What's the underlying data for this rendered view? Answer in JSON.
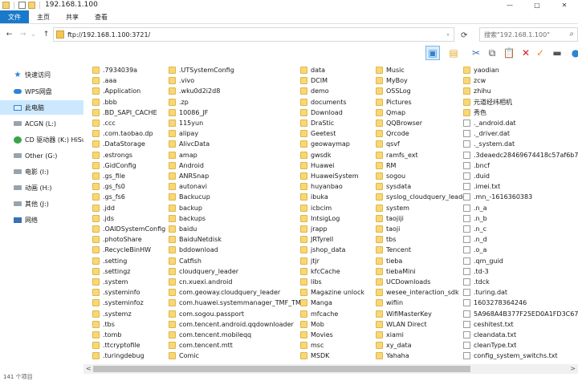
{
  "window": {
    "title": "192.168.1.100",
    "controls": [
      "—",
      "□",
      "✕"
    ]
  },
  "ribbon": {
    "tabs": [
      "文件",
      "主页",
      "共享",
      "查看"
    ]
  },
  "address": {
    "back": "←",
    "forward": "→",
    "recent": "⌄",
    "up": "↑",
    "path": "ftp://192.168.1.100:3721/",
    "dropdown": "⌄",
    "refresh": "⟳",
    "search_placeholder": "搜索\"192.168.1.100\"",
    "search_icon": "⌕"
  },
  "toolbar": {
    "colors": {
      "accent": "#1979ca",
      "selected": "#cce8ff",
      "delete": "#d11a2a",
      "check": "#e98b1a"
    },
    "buttons": [
      {
        "name": "layout-pane-icon",
        "glyph": "▣",
        "color": "#2f84d3"
      },
      {
        "name": "view-options-icon",
        "glyph": "▤",
        "color": "#e0a82e"
      },
      {
        "name": "cut-icon",
        "glyph": "✂",
        "color": "#3b6fb6"
      },
      {
        "name": "copy-icon",
        "glyph": "⧉",
        "color": "#555555"
      },
      {
        "name": "paste-icon",
        "glyph": "📋",
        "color": "#555555"
      },
      {
        "name": "delete-icon",
        "glyph": "✕",
        "color": "#d11a2a"
      },
      {
        "name": "checkmark-icon",
        "glyph": "✓",
        "color": "#e98b1a"
      },
      {
        "name": "rename-icon",
        "glyph": "▬",
        "color": "#555555"
      },
      {
        "name": "globe-icon",
        "glyph": "●",
        "color": "#2f84d3"
      }
    ]
  },
  "sidebar": {
    "items": [
      {
        "label": "快速访问",
        "icon": "star-icon"
      },
      {
        "label": "WPS网盘",
        "icon": "cloud-icon"
      },
      {
        "label": "此电脑",
        "icon": "computer-icon",
        "selected": true
      },
      {
        "label": "ACGN (L:)",
        "icon": "drive-icon"
      },
      {
        "label": "CD 驱动器 (K:) HiSu",
        "icon": "cd-drive-icon"
      },
      {
        "label": "Other (G:)",
        "icon": "drive-icon"
      },
      {
        "label": "电影 (I:)",
        "icon": "drive-icon"
      },
      {
        "label": "动画 (H:)",
        "icon": "drive-icon"
      },
      {
        "label": "其他 (J:)",
        "icon": "drive-icon"
      },
      {
        "label": "网络",
        "icon": "network-icon"
      }
    ]
  },
  "files": {
    "columns": [
      [
        {
          "n": ".7934039a",
          "t": "folder"
        },
        {
          "n": ".aaa",
          "t": "folder"
        },
        {
          "n": ".Application",
          "t": "folder"
        },
        {
          "n": ".bbb",
          "t": "folder"
        },
        {
          "n": ".BD_SAPI_CACHE",
          "t": "folder"
        },
        {
          "n": ".ccc",
          "t": "folder"
        },
        {
          "n": ".com.taobao.dp",
          "t": "folder"
        },
        {
          "n": ".DataStorage",
          "t": "folder"
        },
        {
          "n": ".estrongs",
          "t": "folder"
        },
        {
          "n": ".GidConfig",
          "t": "folder"
        },
        {
          "n": ".gs_file",
          "t": "folder"
        },
        {
          "n": ".gs_fs0",
          "t": "folder"
        },
        {
          "n": ".gs_fs6",
          "t": "folder"
        },
        {
          "n": ".jdd",
          "t": "folder"
        },
        {
          "n": ".jds",
          "t": "folder"
        },
        {
          "n": ".OAIDSystemConfig",
          "t": "folder"
        },
        {
          "n": ".photoShare",
          "t": "folder"
        },
        {
          "n": ".RecycleBinHW",
          "t": "folder"
        },
        {
          "n": ".setting",
          "t": "folder"
        },
        {
          "n": ".settingz",
          "t": "folder"
        },
        {
          "n": ".system",
          "t": "folder"
        },
        {
          "n": ".systeminfo",
          "t": "folder"
        },
        {
          "n": ".systeminfoz",
          "t": "folder"
        },
        {
          "n": ".systemz",
          "t": "folder"
        },
        {
          "n": ".tbs",
          "t": "folder"
        },
        {
          "n": ".tomb",
          "t": "folder"
        },
        {
          "n": ".ttcryptofile",
          "t": "folder"
        },
        {
          "n": ".turingdebug",
          "t": "folder"
        }
      ],
      [
        {
          "n": ".UTSystemConfig",
          "t": "folder"
        },
        {
          "n": ".vivo",
          "t": "folder"
        },
        {
          "n": ".wku0d2i2d8",
          "t": "folder"
        },
        {
          "n": ".zp",
          "t": "folder"
        },
        {
          "n": "10086_JF",
          "t": "folder"
        },
        {
          "n": "115yun",
          "t": "folder"
        },
        {
          "n": "alipay",
          "t": "folder"
        },
        {
          "n": "AlivcData",
          "t": "folder"
        },
        {
          "n": "amap",
          "t": "folder"
        },
        {
          "n": "Android",
          "t": "folder"
        },
        {
          "n": "ANRSnap",
          "t": "folder"
        },
        {
          "n": "autonavi",
          "t": "folder"
        },
        {
          "n": "Backucup",
          "t": "folder"
        },
        {
          "n": "backup",
          "t": "folder"
        },
        {
          "n": "backups",
          "t": "folder"
        },
        {
          "n": "baidu",
          "t": "folder"
        },
        {
          "n": "BaiduNetdisk",
          "t": "folder"
        },
        {
          "n": "bddownload",
          "t": "folder"
        },
        {
          "n": "Catfish",
          "t": "folder"
        },
        {
          "n": "cloudquery_leader",
          "t": "folder"
        },
        {
          "n": "cn.xuexi.android",
          "t": "folder"
        },
        {
          "n": "com.geoway.cloudquery_leader",
          "t": "folder"
        },
        {
          "n": "com.huawei.systemmanager_TMF_TMS",
          "t": "folder"
        },
        {
          "n": "com.sogou.passport",
          "t": "folder"
        },
        {
          "n": "com.tencent.android.qqdownloader",
          "t": "folder"
        },
        {
          "n": "com.tencent.mobileqq",
          "t": "folder"
        },
        {
          "n": "com.tencent.mtt",
          "t": "folder"
        },
        {
          "n": "Comic",
          "t": "folder"
        }
      ],
      [
        {
          "n": "data",
          "t": "folder"
        },
        {
          "n": "DCIM",
          "t": "folder"
        },
        {
          "n": "demo",
          "t": "folder"
        },
        {
          "n": "documents",
          "t": "folder"
        },
        {
          "n": "Download",
          "t": "folder"
        },
        {
          "n": "DraStic",
          "t": "folder"
        },
        {
          "n": "Geetest",
          "t": "folder"
        },
        {
          "n": "geowaymap",
          "t": "folder"
        },
        {
          "n": "gwsdk",
          "t": "folder"
        },
        {
          "n": "Huawei",
          "t": "folder"
        },
        {
          "n": "HuaweiSystem",
          "t": "folder"
        },
        {
          "n": "huyanbao",
          "t": "folder"
        },
        {
          "n": "ibuka",
          "t": "folder"
        },
        {
          "n": "icbcim",
          "t": "folder"
        },
        {
          "n": "IntsigLog",
          "t": "folder"
        },
        {
          "n": "jrapp",
          "t": "folder"
        },
        {
          "n": "JRTyrell",
          "t": "folder"
        },
        {
          "n": "jshop_data",
          "t": "folder"
        },
        {
          "n": "jtjr",
          "t": "folder"
        },
        {
          "n": "kfcCache",
          "t": "folder"
        },
        {
          "n": "libs",
          "t": "folder"
        },
        {
          "n": "Magazine unlock",
          "t": "folder"
        },
        {
          "n": "Manga",
          "t": "folder"
        },
        {
          "n": "mfcache",
          "t": "folder"
        },
        {
          "n": "Mob",
          "t": "folder"
        },
        {
          "n": "Movies",
          "t": "folder"
        },
        {
          "n": "msc",
          "t": "folder"
        },
        {
          "n": "MSDK",
          "t": "folder"
        }
      ],
      [
        {
          "n": "Music",
          "t": "folder"
        },
        {
          "n": "MyBoy",
          "t": "folder"
        },
        {
          "n": "OSSLog",
          "t": "folder"
        },
        {
          "n": "Pictures",
          "t": "folder"
        },
        {
          "n": "Qmap",
          "t": "folder"
        },
        {
          "n": "QQBrowser",
          "t": "folder"
        },
        {
          "n": "Qrcode",
          "t": "folder"
        },
        {
          "n": "qsvf",
          "t": "folder"
        },
        {
          "n": "ramfs_ext",
          "t": "folder"
        },
        {
          "n": "RM",
          "t": "folder"
        },
        {
          "n": "sogou",
          "t": "folder"
        },
        {
          "n": "sysdata",
          "t": "folder"
        },
        {
          "n": "syslog_cloudquery_leader",
          "t": "folder"
        },
        {
          "n": "system",
          "t": "folder"
        },
        {
          "n": "taojiji",
          "t": "folder"
        },
        {
          "n": "taoji",
          "t": "folder"
        },
        {
          "n": "tbs",
          "t": "folder"
        },
        {
          "n": "Tencent",
          "t": "folder"
        },
        {
          "n": "tieba",
          "t": "folder"
        },
        {
          "n": "tiebaMini",
          "t": "folder"
        },
        {
          "n": "UCDownloads",
          "t": "folder"
        },
        {
          "n": "wesee_interaction_sdk",
          "t": "folder"
        },
        {
          "n": "wifiin",
          "t": "folder"
        },
        {
          "n": "WifiMasterKey",
          "t": "folder"
        },
        {
          "n": "WLAN Direct",
          "t": "folder"
        },
        {
          "n": "xiami",
          "t": "folder"
        },
        {
          "n": "xy_data",
          "t": "folder"
        },
        {
          "n": "Yahaha",
          "t": "folder"
        }
      ],
      [
        {
          "n": "yaodian",
          "t": "folder"
        },
        {
          "n": "zcw",
          "t": "folder"
        },
        {
          "n": "zhihu",
          "t": "folder"
        },
        {
          "n": "元道经纬相机",
          "t": "folder"
        },
        {
          "n": "秀色",
          "t": "folder"
        },
        {
          "n": "._android.dat",
          "t": "file"
        },
        {
          "n": "._driver.dat",
          "t": "file"
        },
        {
          "n": "._system.dat",
          "t": "file"
        },
        {
          "n": ".3deaedc28469674418c57af6b7cc832",
          "t": "file"
        },
        {
          "n": ".bncf",
          "t": "file"
        },
        {
          "n": ".duid",
          "t": "file"
        },
        {
          "n": ".imei.txt",
          "t": "file"
        },
        {
          "n": ".mn_-1616360383",
          "t": "file"
        },
        {
          "n": ".n_a",
          "t": "file"
        },
        {
          "n": ".n_b",
          "t": "file"
        },
        {
          "n": ".n_c",
          "t": "file"
        },
        {
          "n": ".n_d",
          "t": "file"
        },
        {
          "n": ".o_a",
          "t": "file"
        },
        {
          "n": ".qm_guid",
          "t": "file"
        },
        {
          "n": ".td-3",
          "t": "file"
        },
        {
          "n": ".tdck",
          "t": "file"
        },
        {
          "n": ".turing.dat",
          "t": "file"
        },
        {
          "n": "1603278364246",
          "t": "file"
        },
        {
          "n": "5A968A4B377F25ED0A1FD3C67B0CE",
          "t": "file"
        },
        {
          "n": "ceshitest.txt",
          "t": "file"
        },
        {
          "n": "cleandata.txt",
          "t": "file"
        },
        {
          "n": "cleanType.txt",
          "t": "file"
        },
        {
          "n": "config_system_switchs.txt",
          "t": "file"
        }
      ]
    ]
  },
  "scrollbar": {
    "left_arrow": "<",
    "right_arrow": ">"
  },
  "status": {
    "text": "141 个项目"
  }
}
